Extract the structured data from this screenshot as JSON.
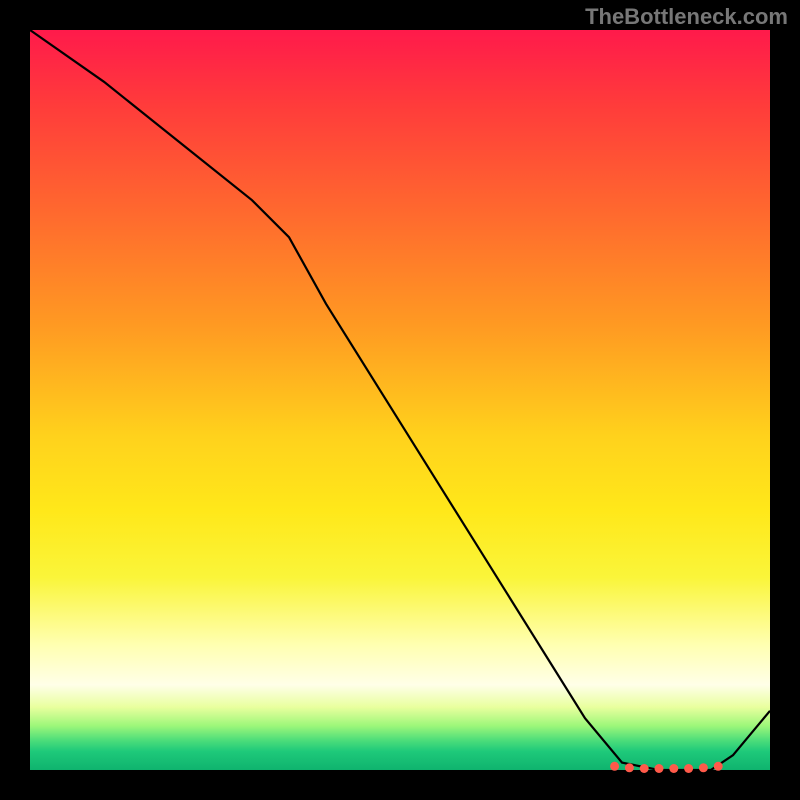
{
  "attribution": "TheBottleneck.com",
  "chart_data": {
    "type": "line",
    "title": "",
    "xlabel": "",
    "ylabel": "",
    "x": [
      0,
      10,
      20,
      30,
      35,
      40,
      50,
      60,
      70,
      75,
      80,
      85,
      88,
      90,
      92,
      95,
      100
    ],
    "values": [
      100,
      93,
      85,
      77,
      72,
      63,
      47,
      31,
      15,
      7,
      1,
      0,
      0,
      0,
      0,
      2,
      8
    ],
    "xlim": [
      0,
      100
    ],
    "ylim": [
      0,
      100
    ],
    "markers_x": [
      79,
      81,
      83,
      85,
      87,
      89,
      91,
      93
    ],
    "markers_y": [
      0.5,
      0.3,
      0.2,
      0.2,
      0.2,
      0.2,
      0.3,
      0.5
    ],
    "grid": false,
    "legend": false,
    "gradient_stops": [
      {
        "pos": 0,
        "color": "#ff1a4b"
      },
      {
        "pos": 0.55,
        "color": "#ffd21c"
      },
      {
        "pos": 0.9,
        "color": "#ffffe0"
      },
      {
        "pos": 1.0,
        "color": "#0fb36e"
      }
    ]
  }
}
